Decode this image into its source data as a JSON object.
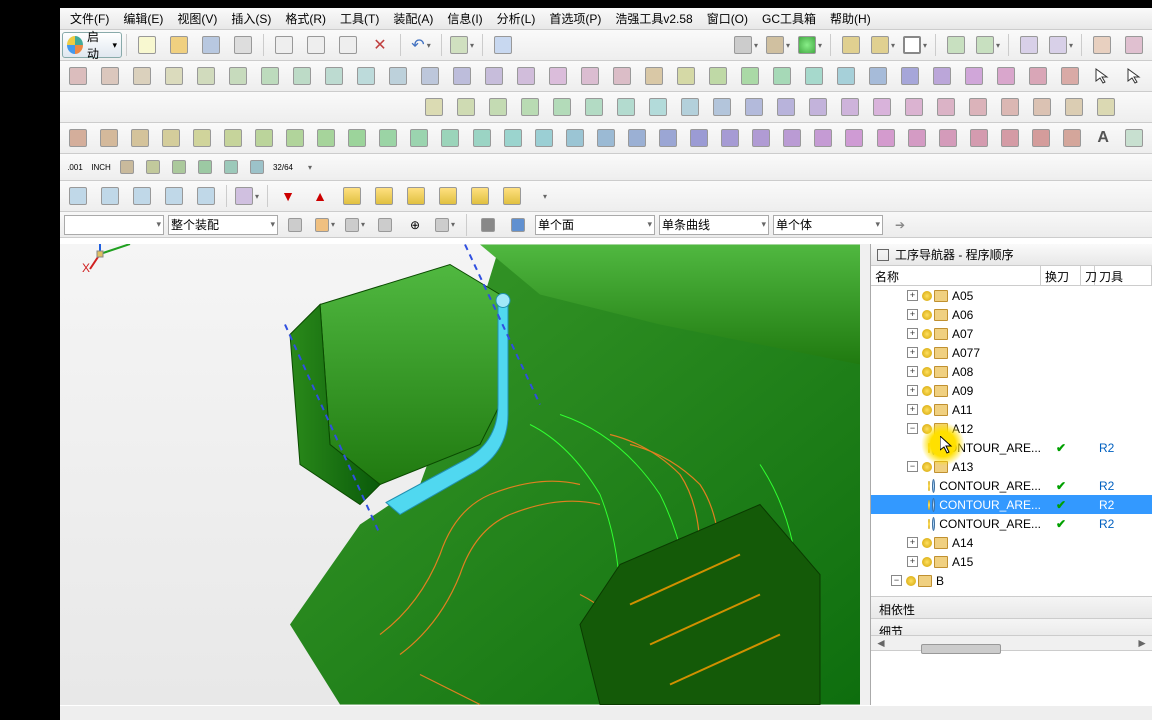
{
  "menu": {
    "file": "文件(F)",
    "edit": "编辑(E)",
    "view": "视图(V)",
    "insert": "插入(S)",
    "format": "格式(R)",
    "tool": "工具(T)",
    "assembly": "装配(A)",
    "info": "信息(I)",
    "analyze": "分析(L)",
    "pref": "首选项(P)",
    "hq": "浩强工具v2.58",
    "window": "窗口(O)",
    "gc": "GC工具箱",
    "help": "帮助(H)"
  },
  "start_label": "启动",
  "filters": {
    "type": "整个装配",
    "face": "单个面",
    "curve": "单条曲线",
    "body": "单个体"
  },
  "nav": {
    "title": "工序导航器 - 程序顺序",
    "col_name": "名称",
    "col2": "换刀",
    "col3": "刀",
    "col4": "刀具"
  },
  "tree": [
    {
      "level": 2,
      "exp": "plus",
      "type": "prog",
      "label": "A05"
    },
    {
      "level": 2,
      "exp": "plus",
      "type": "prog",
      "label": "A06"
    },
    {
      "level": 2,
      "exp": "plus",
      "type": "prog",
      "label": "A07"
    },
    {
      "level": 2,
      "exp": "plus",
      "type": "prog",
      "label": "A077"
    },
    {
      "level": 2,
      "exp": "plus",
      "type": "prog",
      "label": "A08"
    },
    {
      "level": 2,
      "exp": "plus",
      "type": "prog",
      "label": "A09"
    },
    {
      "level": 2,
      "exp": "plus",
      "type": "prog",
      "label": "A11"
    },
    {
      "level": 2,
      "exp": "minus",
      "type": "prog",
      "label": "A12"
    },
    {
      "level": 3,
      "exp": "none",
      "type": "op",
      "label": "CONTOUR_ARE...",
      "chk": true,
      "tool": "R2"
    },
    {
      "level": 2,
      "exp": "minus",
      "type": "prog",
      "label": "A13"
    },
    {
      "level": 3,
      "exp": "none",
      "type": "op",
      "label": "CONTOUR_ARE...",
      "chk": true,
      "tool": "R2"
    },
    {
      "level": 3,
      "exp": "none",
      "type": "op",
      "label": "CONTOUR_ARE...",
      "chk": true,
      "tool": "R2",
      "selected": true
    },
    {
      "level": 3,
      "exp": "none",
      "type": "op",
      "label": "CONTOUR_ARE...",
      "chk": true,
      "tool": "R2"
    },
    {
      "level": 2,
      "exp": "plus",
      "type": "prog",
      "label": "A14"
    },
    {
      "level": 2,
      "exp": "plus",
      "type": "prog",
      "label": "A15"
    },
    {
      "level": 1,
      "exp": "minus",
      "type": "prog",
      "label": "B"
    }
  ],
  "sections": {
    "dep": "相依性",
    "detail": "细节"
  }
}
